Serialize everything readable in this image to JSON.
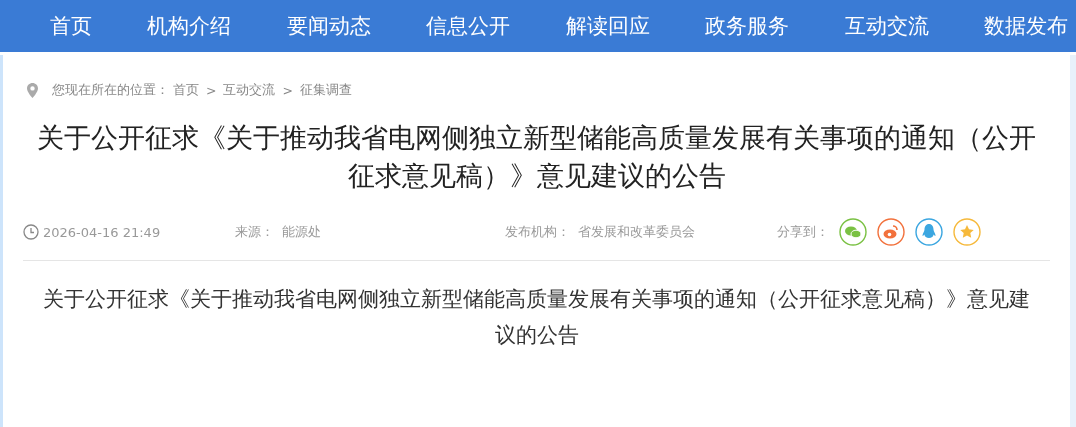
{
  "nav": [
    {
      "label": "首页"
    },
    {
      "label": "机构介绍"
    },
    {
      "label": "要闻动态"
    },
    {
      "label": "信息公开"
    },
    {
      "label": "解读回应"
    },
    {
      "label": "政务服务"
    },
    {
      "label": "互动交流"
    },
    {
      "label": "数据发布"
    }
  ],
  "breadcrumb": {
    "label": "您现在所在的位置：",
    "separator": ">",
    "items": [
      "首页",
      "互动交流",
      "征集调查"
    ]
  },
  "article": {
    "title": "关于公开征求《关于推动我省电网侧独立新型储能高质量发展有关事项的通知（公开征求意见稿）》意见建议的公告",
    "date": "2026-04-16 21:49",
    "source_label": "来源：",
    "source": "能源处",
    "publisher_label": "发布机构：",
    "publisher": "省发展和改革委员会",
    "share_label": "分享到：",
    "share": [
      {
        "kind": "wechat",
        "color": "#7ac143"
      },
      {
        "kind": "weibo",
        "color": "#f2713c"
      },
      {
        "kind": "qq",
        "color": "#3ba6e0"
      },
      {
        "kind": "star",
        "color": "#f6b93b"
      }
    ],
    "body": "关于公开征求《关于推动我省电网侧独立新型储能高质量发展有关事项的通知（公开征求意见稿）》意见建议的公告"
  }
}
